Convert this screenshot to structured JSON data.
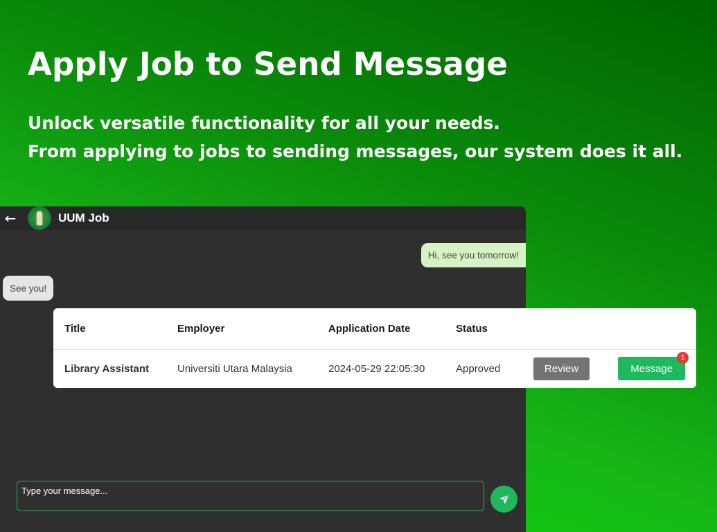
{
  "hero": {
    "title": "Apply Job to Send Message",
    "subtitle_line1": "Unlock versatile functionality for all your needs.",
    "subtitle_line2": "From applying to jobs to sending messages, our system does it all."
  },
  "chat": {
    "header": {
      "back_icon": "arrow-left-icon",
      "logo": "uum-logo",
      "app_name": "UUM Job"
    },
    "messages": [
      {
        "direction": "sent",
        "text": "Hi, see you tomorrow!"
      },
      {
        "direction": "received",
        "text": "See you!"
      }
    ],
    "composer": {
      "placeholder": "Type your message...",
      "send_icon": "paper-plane-icon"
    }
  },
  "applications": {
    "columns": [
      "Title",
      "Employer",
      "Application Date",
      "Status"
    ],
    "rows": [
      {
        "title": "Library Assistant",
        "employer": "Universiti Utara Malaysia",
        "date": "2024-05-29 22:05:30",
        "status": "Approved",
        "review_label": "Review",
        "message_label": "Message",
        "unread_count": "1"
      }
    ]
  },
  "colors": {
    "accent_green": "#1fb85c",
    "review_grey": "#747474",
    "badge_red": "#e53935",
    "sent_bubble": "#d7f3c6",
    "received_bubble": "#e6e6e6"
  }
}
